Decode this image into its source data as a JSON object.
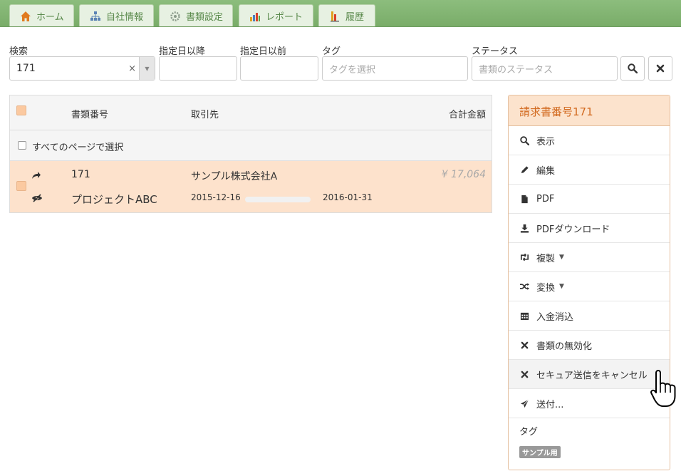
{
  "nav": {
    "tabs": [
      {
        "label": "ホーム",
        "icon": "home-icon"
      },
      {
        "label": "自社情報",
        "icon": "org-chart-icon"
      },
      {
        "label": "書類設定",
        "icon": "gear-icon"
      },
      {
        "label": "レポート",
        "icon": "bar-chart-icon"
      },
      {
        "label": "履歴",
        "icon": "history-icon"
      }
    ]
  },
  "filters": {
    "search_label": "検索",
    "search_value": "171",
    "date_from_label": "指定日以降",
    "date_to_label": "指定日以前",
    "tag_label": "タグ",
    "tag_placeholder": "タグを選択",
    "status_label": "ステータス",
    "status_placeholder": "書類のステータス"
  },
  "table": {
    "headers": {
      "number": "書類番号",
      "client": "取引先",
      "total": "合計金額"
    },
    "select_all_pages": "すべてのページで選択",
    "rows": [
      {
        "number": "171",
        "project": "プロジェクトABC",
        "client": "サンプル株式会社A",
        "start_date": "2015-12-16",
        "end_date": "2016-01-31",
        "amount": "¥ 17,064",
        "progress": 0.0
      }
    ]
  },
  "panel": {
    "title": "請求書番号171",
    "actions": [
      {
        "label": "表示",
        "icon": "search-icon"
      },
      {
        "label": "編集",
        "icon": "pencil-icon"
      },
      {
        "label": "PDF",
        "icon": "file-icon"
      },
      {
        "label": "PDFダウンロード",
        "icon": "download-icon"
      },
      {
        "label": "複製",
        "icon": "retweet-icon"
      },
      {
        "label": "変換",
        "icon": "shuffle-icon"
      },
      {
        "label": "入金消込",
        "icon": "calendar-icon"
      },
      {
        "label": "書類の無効化",
        "icon": "times-icon"
      },
      {
        "label": "セキュア送信をキャンセル",
        "icon": "times-icon"
      },
      {
        "label": "送付...",
        "icon": "send-icon"
      }
    ],
    "tags_title": "タグ",
    "tag": "サンプル用"
  },
  "colors": {
    "nav_green": "#79ac68",
    "row_highlight": "#fde2cc",
    "panel_title": "#d2691e"
  }
}
